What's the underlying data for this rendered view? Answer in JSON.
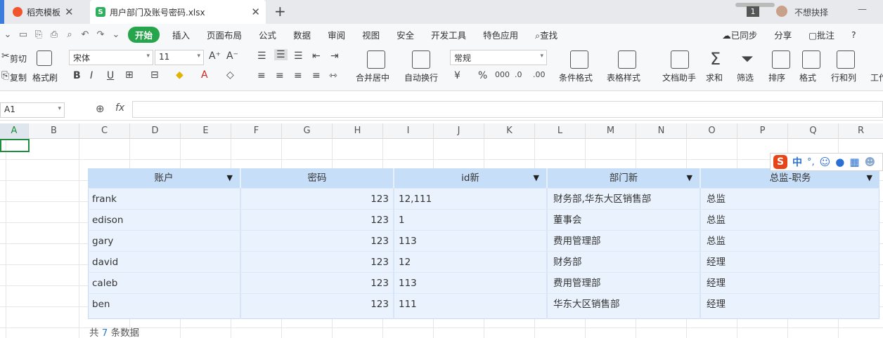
{
  "titlebar": {
    "tab1": "稻壳模板",
    "tab2": "用户部门及账号密码.xlsx",
    "new_tab": "+",
    "page_badge": "1",
    "username": "不想抉择",
    "minimize": "—",
    "close": "×"
  },
  "menu": {
    "items": [
      "开始",
      "插入",
      "页面布局",
      "公式",
      "数据",
      "审阅",
      "视图",
      "安全",
      "开发工具",
      "特色应用"
    ],
    "active": "开始",
    "search": "查找",
    "sync": "已同步",
    "share": "分享",
    "annotate": "批注",
    "help": "?"
  },
  "ribbon": {
    "cut": "剪切",
    "copy": "复制",
    "format_painter": "格式刷",
    "font": "宋体",
    "size": "11",
    "grow": "A⁺",
    "shrink": "A⁻",
    "bold": "B",
    "italic": "I",
    "underline": "U",
    "merge": "合并居中",
    "wrap": "自动换行",
    "number_format": "常规",
    "percent": "%",
    "conditional": "条件格式",
    "table_style": "表格样式",
    "doc_helper": "文档助手",
    "sum": "求和",
    "filter": "筛选",
    "sort": "排序",
    "format": "格式",
    "rowcol": "行和列",
    "work": "工作"
  },
  "formula": {
    "cell_ref": "A1",
    "fx": "fx",
    "value": ""
  },
  "columns": [
    "A",
    "B",
    "C",
    "D",
    "E",
    "F",
    "G",
    "H",
    "I",
    "J",
    "K",
    "L",
    "M",
    "N",
    "O",
    "P",
    "Q",
    "R"
  ],
  "ime": {
    "logo": "S",
    "lang": "中",
    "punct": "°,"
  },
  "table": {
    "headers": [
      "账户",
      "密码",
      "id新",
      "部门新",
      "总监-职务"
    ],
    "rows": [
      {
        "account": "frank",
        "password": "123",
        "id": "12,111",
        "dept": "财务部,华东大区销售部",
        "title": "总监"
      },
      {
        "account": "edison",
        "password": "123",
        "id": "1",
        "dept": "董事会",
        "title": "总监"
      },
      {
        "account": "gary",
        "password": "123",
        "id": "113",
        "dept": "费用管理部",
        "title": "总监"
      },
      {
        "account": "david",
        "password": "123",
        "id": "12",
        "dept": "财务部",
        "title": "经理"
      },
      {
        "account": "caleb",
        "password": "123",
        "id": "113",
        "dept": "费用管理部",
        "title": "经理"
      },
      {
        "account": "ben",
        "password": "123",
        "id": "111",
        "dept": "华东大区销售部",
        "title": "经理"
      }
    ]
  },
  "footer": {
    "prefix": "共",
    "count": "7",
    "suffix": "条数据"
  },
  "colors": {
    "accent": "#27a54c",
    "header_fill": "#c6def7",
    "table_fill": "#eaf3fd",
    "link": "#2f7bd9"
  }
}
